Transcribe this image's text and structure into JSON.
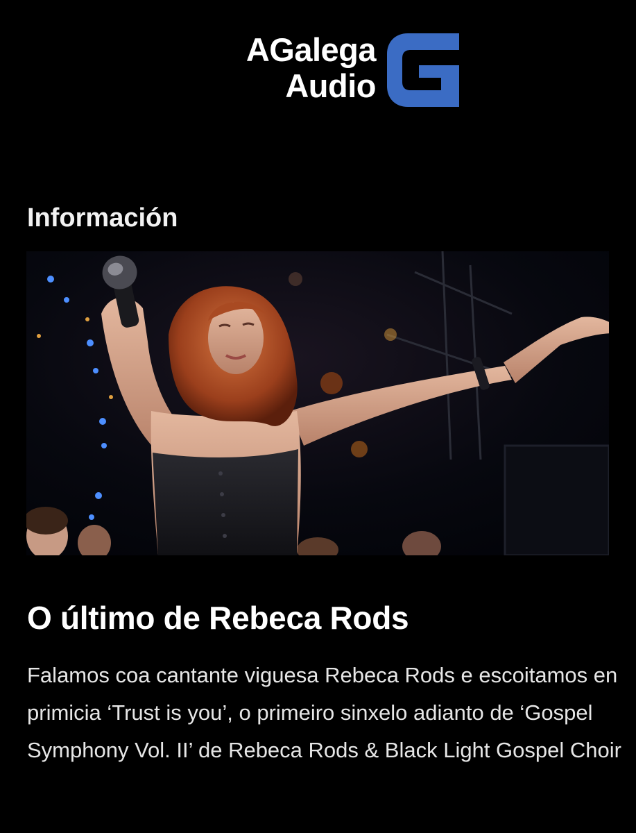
{
  "header": {
    "logo_line1": "AGalega",
    "logo_line2": "Audio",
    "logo_mark_letter": "G",
    "brand_color": "#3b6cc4"
  },
  "section": {
    "title": "Información"
  },
  "article": {
    "title": "O último de Rebeca Rods",
    "summary": "Falamos coa cantante viguesa Rebeca Rods e escoitamos en primicia ‘Trust is you’, o primeiro sinxelo adianto de ‘Gospel Symphony Vol. II’ de Rebeca Rods & Black Light Gospel Choir"
  }
}
